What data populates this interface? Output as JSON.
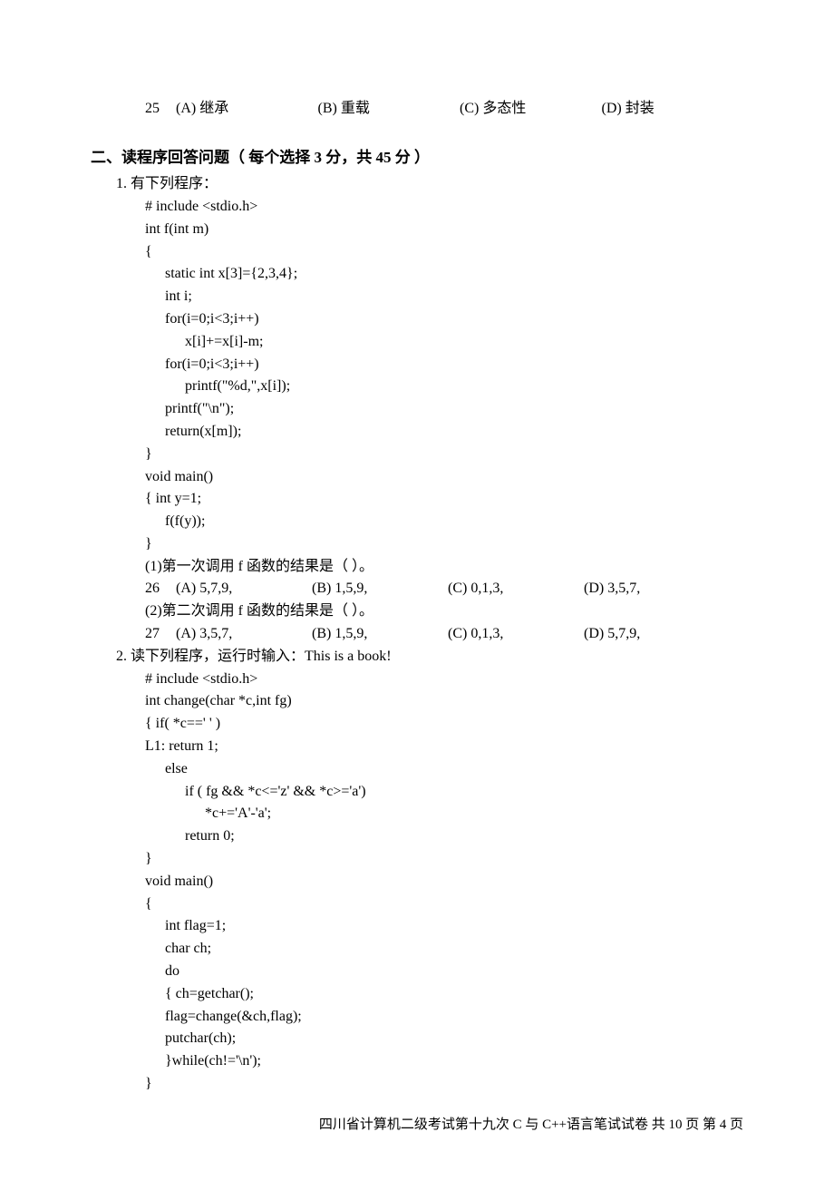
{
  "top_q": {
    "num": "25",
    "opts": {
      "a": "(A) 继承",
      "b": "(B) 重载",
      "c": "(C) 多态性",
      "d": "(D) 封装"
    }
  },
  "section2": {
    "heading": "二、读程序回答问题（ 每个选择 3 分，共 45 分 ）",
    "q1": {
      "title": "1.  有下列程序：",
      "code": [
        "# include <stdio.h>",
        "int f(int m)",
        "{",
        "    static int x[3]={2,3,4};",
        "    int i;",
        "    for(i=0;i<3;i++)",
        "         x[i]+=x[i]-m;",
        "    for(i=0;i<3;i++)",
        "         printf(\"%d,\",x[i]);",
        "    printf(\"\\n\");",
        "    return(x[m]);",
        "}",
        "void main()",
        "{ int y=1;",
        "    f(f(y));",
        "}"
      ],
      "sub1": {
        "text": "(1)第一次调用 f 函数的结果是（    ）。",
        "num": "26",
        "opts": {
          "a": "(A) 5,7,9,",
          "b": "(B) 1,5,9,",
          "c": "(C) 0,1,3,",
          "d": "(D) 3,5,7,"
        }
      },
      "sub2": {
        "text": "(2)第二次调用 f 函数的结果是（    ）。",
        "num": "27",
        "opts": {
          "a": "(A) 3,5,7,",
          "b": "(B) 1,5,9,",
          "c": "(C) 0,1,3,",
          "d": "(D) 5,7,9,"
        }
      }
    },
    "q2": {
      "title": "2.  读下列程序，运行时输入：This is a book!",
      "code": [
        "# include <stdio.h>",
        "int change(char *c,int fg)",
        "{    if( *c==' ' )",
        "  L1:    return 1;",
        "       else",
        "            if ( fg && *c<='z' && *c>='a')",
        "                 *c+='A'-'a';",
        "          return 0;",
        "}",
        "void main()",
        "{",
        "    int flag=1;",
        "    char ch;",
        "    do",
        "    { ch=getchar();",
        "       flag=change(&ch,flag);",
        "       putchar(ch);",
        "    }while(ch!='\\n');",
        "}"
      ]
    }
  },
  "footer": "四川省计算机二级考试第十九次 C 与 C++语言笔试试卷  共 10 页    第 4 页"
}
